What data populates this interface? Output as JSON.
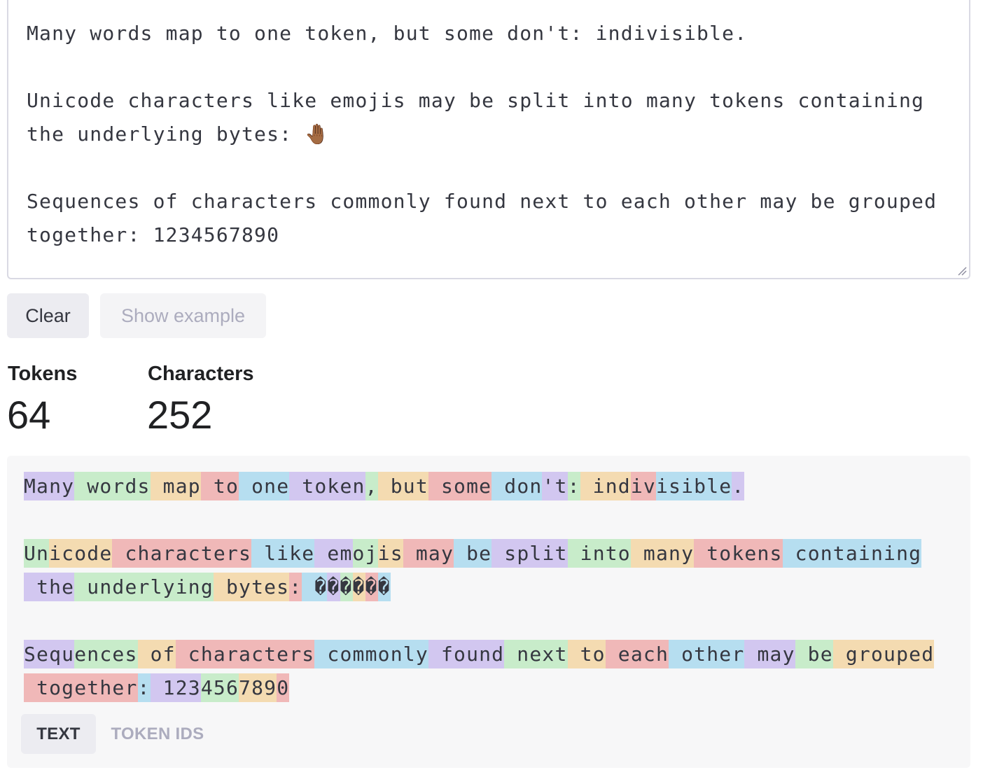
{
  "editor": {
    "text": "Many words map to one token, but some don't: indivisible.\n\nUnicode characters like emojis may be split into many tokens containing the underlying bytes: 🤚🏾\n\nSequences of characters commonly found next to each other may be grouped together: 1234567890"
  },
  "buttons": {
    "clear": "Clear",
    "show_example": "Show example"
  },
  "stats": {
    "tokens_label": "Tokens",
    "tokens_value": "64",
    "characters_label": "Characters",
    "characters_value": "252"
  },
  "colors": {
    "token_palette": [
      "#d2c7f0",
      "#c8ecca",
      "#f4dbb1",
      "#f0b8b8",
      "#b6def0"
    ]
  },
  "tokens": [
    "Many",
    " words",
    " map",
    " to",
    " one",
    " token",
    ",",
    " but",
    " some",
    " don",
    "'t",
    ":",
    " ind",
    "iv",
    "isible",
    ".",
    "\n\n",
    "Un",
    "icode",
    " characters",
    " like",
    " em",
    "oj",
    "is",
    " may",
    " be",
    " split",
    " into",
    " many",
    " tokens",
    " containing",
    "\n",
    " the",
    " underlying",
    " bytes",
    ":",
    " �",
    "�",
    "�",
    "�",
    "�",
    "�",
    "\n\n",
    "Sequ",
    "ences",
    " of",
    " characters",
    " commonly",
    " found",
    " next",
    " to",
    " each",
    " other",
    " may",
    " be",
    " grouped",
    "\n",
    " together",
    ":",
    " 123",
    "456",
    "789",
    "0"
  ],
  "tabs": {
    "text": "TEXT",
    "token_ids": "TOKEN IDS"
  }
}
